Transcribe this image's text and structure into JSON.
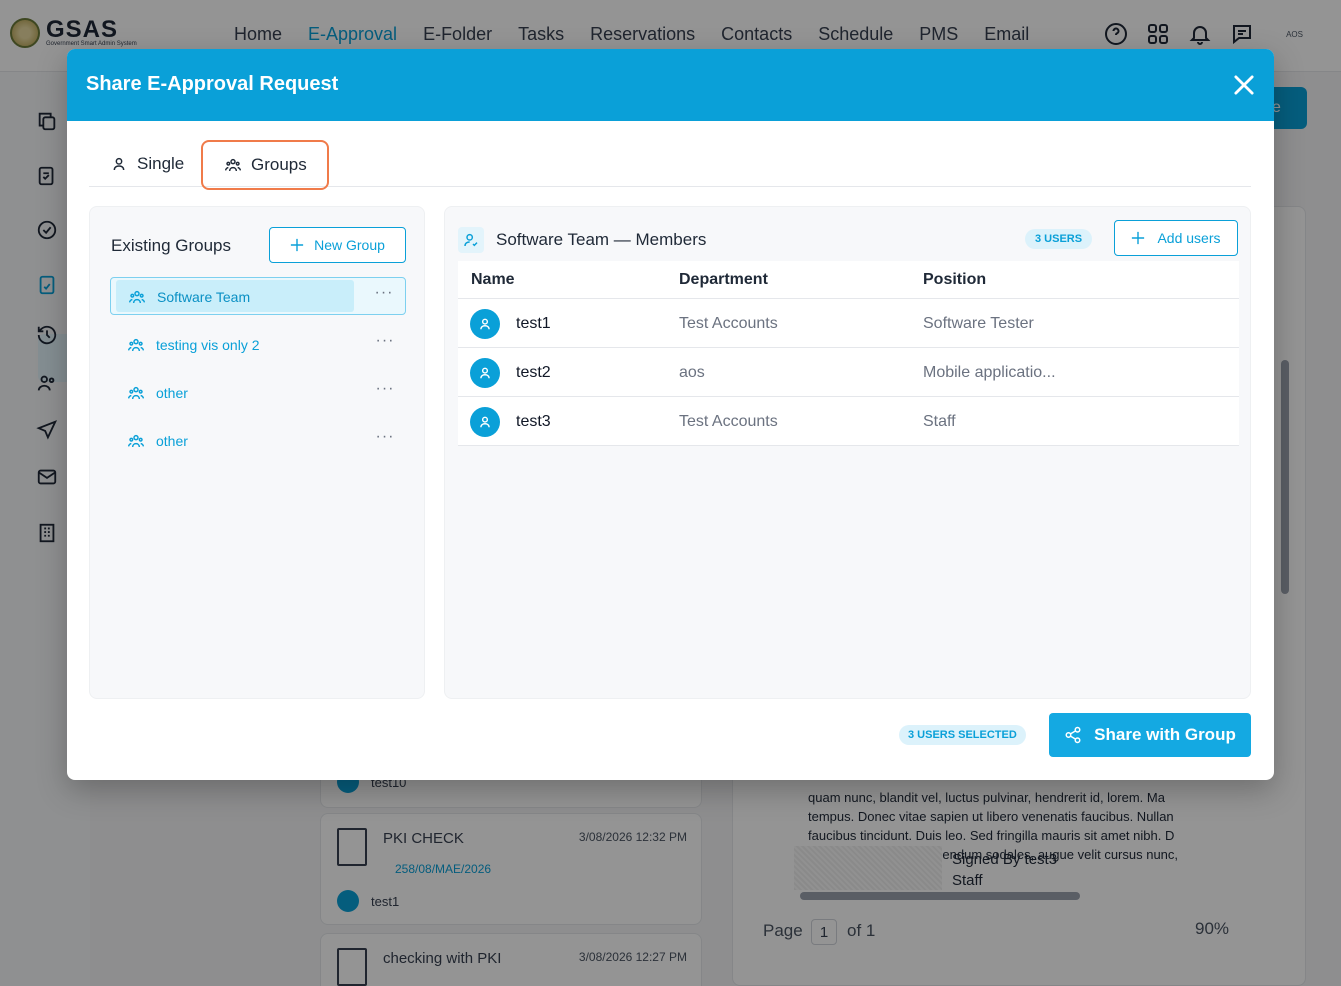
{
  "app": {
    "logo_name": "GSAS",
    "logo_sub": "Government Smart Admin System",
    "nav": [
      "Home",
      "E-Approval",
      "E-Folder",
      "Tasks",
      "Reservations",
      "Contacts",
      "Schedule",
      "PMS",
      "Email"
    ],
    "active_nav": "E-Approval",
    "user_initials": "AOS"
  },
  "background": {
    "button_partial": "e",
    "cards": [
      {
        "title": "",
        "date": "",
        "ref": "",
        "user": "test10"
      },
      {
        "title": "PKI CHECK",
        "date": "3/08/2026 12:32 PM",
        "ref": "258/08/MAE/2026",
        "user": "test1"
      },
      {
        "title": "checking with PKI",
        "date": "3/08/2026 12:27 PM",
        "ref": "",
        "user": ""
      }
    ],
    "preview_lines": [
      "quam nunc, blandit vel, luctus pulvinar, hendrerit id, lorem. Ma",
      "tempus. Donec vitae sapien ut libero venenatis faucibus. Nullan",
      "faucibus tincidunt. Duis leo. Sed fringilla mauris sit amet nibh. D",
      "consequat, leo eget bibendum sodales, augue velit cursus nunc,"
    ],
    "signed_by": "Signed By  test3",
    "signed_role": "Staff",
    "page_label": "Page",
    "page_num": "1",
    "page_of": "of 1",
    "zoom": "90%"
  },
  "modal": {
    "title": "Share E-Approval Request",
    "tabs": [
      {
        "label": "Single",
        "icon": "user-icon"
      },
      {
        "label": "Groups",
        "icon": "users-icon",
        "active": true
      }
    ],
    "groups_panel": {
      "header": "Existing Groups",
      "new_group_label": "New Group",
      "groups": [
        {
          "name": "Software Team",
          "selected": true
        },
        {
          "name": "testing vis only 2",
          "selected": false
        },
        {
          "name": "other",
          "selected": false
        },
        {
          "name": "other",
          "selected": false
        }
      ],
      "menu_glyph": "···"
    },
    "members_panel": {
      "title": "Software Team — Members",
      "count_badge": "3 USERS",
      "add_users_label": "Add users",
      "columns": [
        "Name",
        "Department",
        "Position"
      ],
      "rows": [
        {
          "name": "test1",
          "department": "Test Accounts",
          "position": "Software Tester"
        },
        {
          "name": "test2",
          "department": "aos",
          "position": "Mobile applicatio..."
        },
        {
          "name": "test3",
          "department": "Test Accounts",
          "position": "Staff"
        }
      ]
    },
    "footer": {
      "selected_badge": "3 USERS SELECTED",
      "share_label": "Share with Group"
    },
    "colors": {
      "primary": "#0aa0d8",
      "tab_highlight": "#f07b4a",
      "badge_bg": "#dcf2fb"
    }
  }
}
